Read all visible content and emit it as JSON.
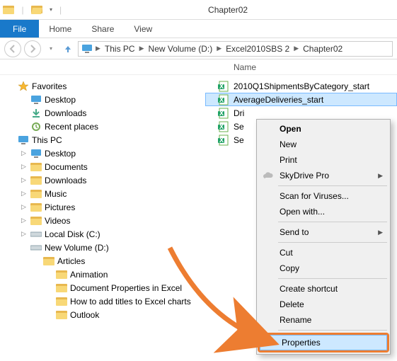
{
  "window": {
    "title": "Chapter02"
  },
  "ribbon": {
    "file": "File",
    "tabs": [
      "Home",
      "Share",
      "View"
    ]
  },
  "breadcrumb": {
    "items": [
      "This PC",
      "New Volume (D:)",
      "Excel2010SBS 2",
      "Chapter02"
    ]
  },
  "columns": {
    "name": "Name"
  },
  "nav": {
    "favorites": {
      "label": "Favorites",
      "items": [
        "Desktop",
        "Downloads",
        "Recent places"
      ]
    },
    "thispc": {
      "label": "This PC",
      "items": [
        "Desktop",
        "Documents",
        "Downloads",
        "Music",
        "Pictures",
        "Videos",
        "Local Disk (C:)",
        "New Volume (D:)"
      ],
      "newvol_children": {
        "articles": {
          "label": "Articles",
          "items": [
            "Animation",
            "Document Properties in Excel",
            "How to add titles to Excel charts",
            "Outlook"
          ]
        }
      }
    }
  },
  "files": {
    "items": [
      "2010Q1ShipmentsByCategory_start",
      "AverageDeliveries_start",
      "Dri",
      "Se",
      "Se"
    ],
    "selected_index": 1
  },
  "context_menu": {
    "open": "Open",
    "new": "New",
    "print": "Print",
    "skydrive": "SkyDrive Pro",
    "scan": "Scan for Viruses...",
    "openwith": "Open with...",
    "sendto": "Send to",
    "cut": "Cut",
    "copy": "Copy",
    "shortcut": "Create shortcut",
    "delete": "Delete",
    "rename": "Rename",
    "properties": "Properties"
  }
}
